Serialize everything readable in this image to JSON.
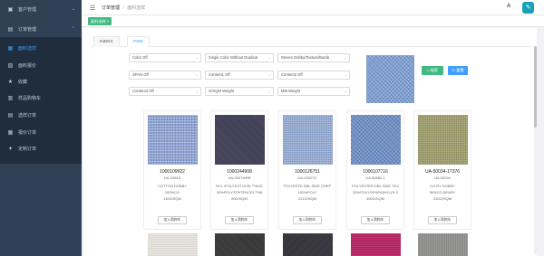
{
  "sidebar": {
    "items": [
      {
        "label": "客户管理",
        "icon": "user-icon",
        "arrow": "⌄"
      },
      {
        "label": "订单管理",
        "icon": "order-icon",
        "arrow": "⌃"
      },
      {
        "label": "面料选样",
        "icon": "fabric-icon",
        "active": true
      },
      {
        "label": "面料报价",
        "icon": "quote-icon"
      },
      {
        "label": "收藏",
        "icon": "star-icon"
      },
      {
        "label": "样品购物车",
        "icon": "cart-icon"
      },
      {
        "label": "选样订单",
        "icon": "sample-order-icon"
      },
      {
        "label": "报价订单",
        "icon": "quote-order-icon"
      },
      {
        "label": "定制订单",
        "icon": "custom-order-icon"
      }
    ]
  },
  "header": {
    "breadcrumb_root": "订单管理",
    "breadcrumb_sep": "/",
    "breadcrumb_current": "面料选样",
    "lang_icon": "A",
    "avatar_color": "#17a2b8"
  },
  "tags": {
    "active_tag": "面料选样 ×",
    "active_color": "#42b983"
  },
  "tabs": [
    {
      "label": "INDEX",
      "active": false
    },
    {
      "label": "PIBE",
      "active": true
    }
  ],
  "filters": {
    "row1": [
      "Color Off",
      "Single Color Without Duplicat",
      "Woven Dobby/Texture/Bamb"
    ],
    "row2": [
      "SPAN Off",
      "Content1 Off",
      "Content2 Off"
    ],
    "row3": [
      "Content3 Off",
      "G/SQM Weight",
      "MM Weight"
    ]
  },
  "buttons": {
    "search": "搜索",
    "reset": "重置"
  },
  "products": [
    {
      "code": "1000109922",
      "sub": "UA-33816",
      "desc1": "COTTON DOBBY",
      "desc2": "100%CO",
      "desc3": "110G/SQM",
      "btn": "加入购物车",
      "color": "#8ea4d2"
    },
    {
      "code": "1000244908",
      "sub": "UA-00079/RB",
      "desc1": "NYL /POLY.EXTOCEL™ACE",
      "desc2": "43%POLY37%TENCEL™46",
      "desc3": "90G/SQM",
      "btn": "加入购物车",
      "color": "#3a3850"
    },
    {
      "code": "1000126751",
      "sub": "UA-20527C",
      "desc1": "POLYESTE DBL SIDE CREP",
      "desc2": "100%POLY",
      "desc3": "221G/SQM",
      "btn": "加入购物车",
      "color": "#8fa8d0"
    },
    {
      "code": "1000107716",
      "sub": "UA-50880-1",
      "desc1": "POLYESTER DBL SIDE TEX",
      "desc2": "33%POLY/53%PA(NYL)% 3",
      "desc3": "400G/SQM",
      "btn": "加入购物车",
      "color": "#6e8fc4"
    },
    {
      "code": "UA-50034-17376",
      "sub": "UA-50034",
      "desc1": "CO-RY DOBBY",
      "desc2": "50%CO 50%RY",
      "desc3": "220G/SQM",
      "btn": "加入购物车",
      "color": "#a09f6e"
    }
  ],
  "second_row_colors": [
    "#e9e6e0",
    "#2f2f2f",
    "#2c2b33",
    "#b01e5c",
    "#8a8a88"
  ],
  "preview_color": "#7e9fd3"
}
